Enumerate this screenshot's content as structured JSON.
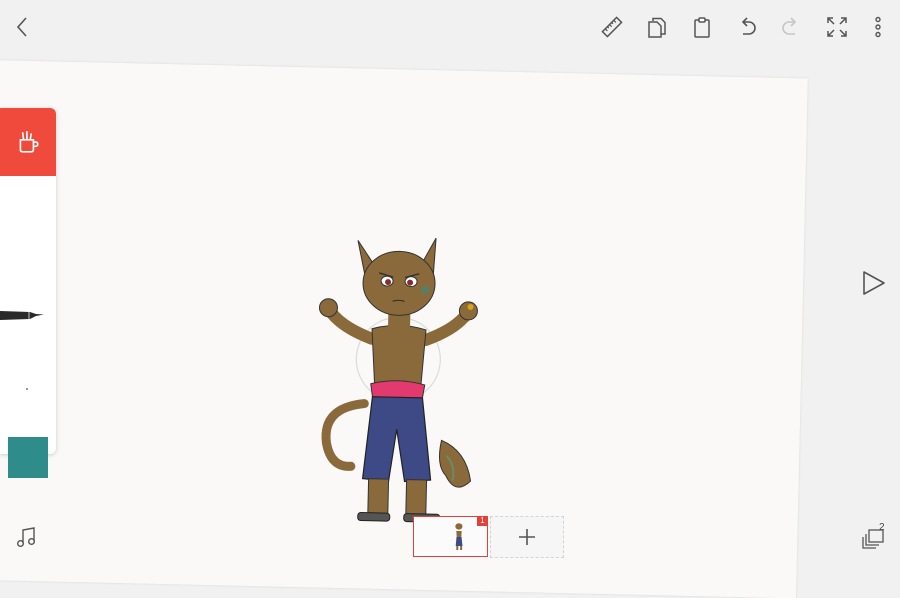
{
  "toolbar": {
    "back_icon": "back-chevron-icon",
    "icons": [
      "ruler-icon",
      "copy-icon",
      "clipboard-icon",
      "undo-icon",
      "redo-icon",
      "fullscreen-icon",
      "more-icon"
    ]
  },
  "tool_panel": {
    "active_tool_icon": "brush-cup-icon",
    "current_tool": "technical-pen",
    "current_color": "#2e8c8a"
  },
  "timeline": {
    "frame_number": "1",
    "add_frame_icon": "plus-icon"
  },
  "layers": {
    "count": "2"
  },
  "colors": {
    "accent": "#f04a3c",
    "canvas": "#faf9f7",
    "background": "#f1f1f1"
  }
}
